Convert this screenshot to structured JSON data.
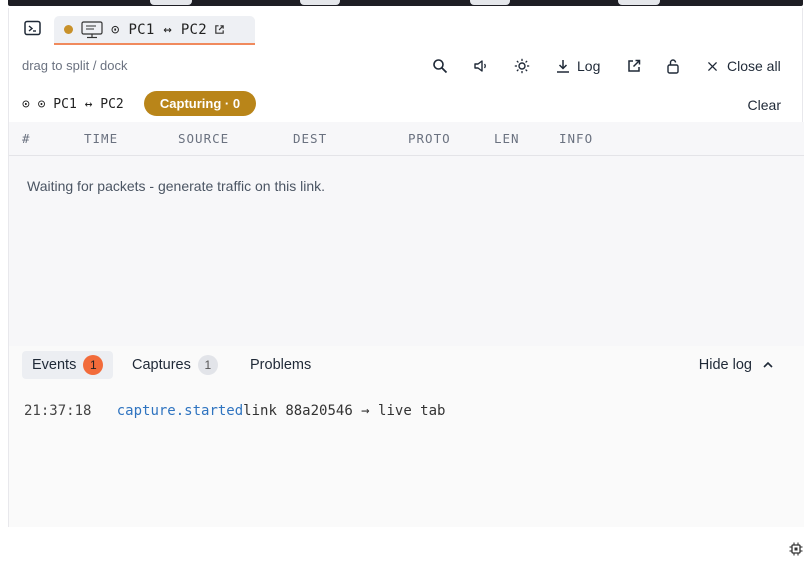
{
  "tabbar": {
    "tab_label": "⊙ PC1 ↔ PC2"
  },
  "toolbar": {
    "hint": "drag to split / dock",
    "log_label": "Log",
    "close_all_label": "Close all"
  },
  "capture": {
    "name": "⊙ ⊙ PC1 ↔ PC2",
    "status": "Capturing · 0",
    "clear_label": "Clear"
  },
  "packets": {
    "columns": [
      "#",
      "TIME",
      "SOURCE",
      "DEST",
      "PROTO",
      "LEN",
      "INFO"
    ],
    "empty_message": "Waiting for packets - generate traffic on this link."
  },
  "log": {
    "tabs": [
      {
        "label": "Events",
        "count": "1"
      },
      {
        "label": "Captures",
        "count": "1"
      },
      {
        "label": "Problems"
      }
    ],
    "hide_label": "Hide log",
    "entries": [
      {
        "time": "21:37:18",
        "event": "capture.started",
        "message": "link 88a20546 → live tab"
      }
    ]
  },
  "colors": {
    "accent_orange": "#f26b3a",
    "capture_gold": "#b98519",
    "event_blue": "#2f74c0"
  }
}
